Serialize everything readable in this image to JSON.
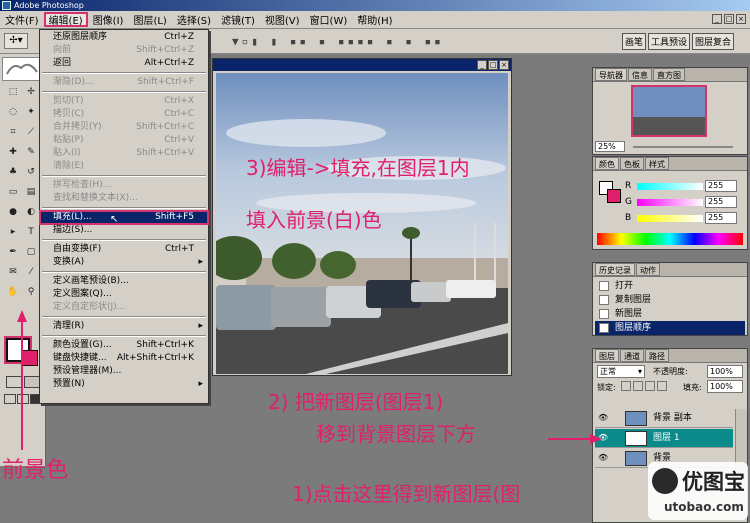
{
  "app": {
    "title": "Adobe Photoshop"
  },
  "menubar": [
    {
      "id": "file",
      "label": "文件(F)"
    },
    {
      "id": "edit",
      "label": "编辑(E)"
    },
    {
      "id": "image",
      "label": "图像(I)"
    },
    {
      "id": "layer",
      "label": "图层(L)"
    },
    {
      "id": "select",
      "label": "选择(S)"
    },
    {
      "id": "filter",
      "label": "滤镜(T)"
    },
    {
      "id": "view",
      "label": "视图(V)"
    },
    {
      "id": "window",
      "label": "窗口(W)"
    },
    {
      "id": "help",
      "label": "帮助(H)"
    }
  ],
  "options_bar": {
    "placeholder_text": "▼▫▮ ▮ ▪▪ ▪  ▪▪▪▪ ▪ ▪ ▪▪"
  },
  "right_toolbar": [
    "画笔",
    "工具预设",
    "图层复合"
  ],
  "edit_menu": [
    {
      "label": "还原图层顺序",
      "shortcut": "Ctrl+Z",
      "enabled": true
    },
    {
      "label": "向前",
      "shortcut": "Shift+Ctrl+Z",
      "enabled": false
    },
    {
      "label": "返回",
      "shortcut": "Alt+Ctrl+Z",
      "enabled": true
    },
    {
      "sep": true
    },
    {
      "label": "渐隐(D)...",
      "shortcut": "Shift+Ctrl+F",
      "enabled": false
    },
    {
      "sep": true
    },
    {
      "label": "剪切(T)",
      "shortcut": "Ctrl+X",
      "enabled": false
    },
    {
      "label": "拷贝(C)",
      "shortcut": "Ctrl+C",
      "enabled": false
    },
    {
      "label": "合并拷贝(Y)",
      "shortcut": "Shift+Ctrl+C",
      "enabled": false
    },
    {
      "label": "粘贴(P)",
      "shortcut": "Ctrl+V",
      "enabled": false
    },
    {
      "label": "贴入(I)",
      "shortcut": "Shift+Ctrl+V",
      "enabled": false
    },
    {
      "label": "清除(E)",
      "shortcut": "",
      "enabled": false
    },
    {
      "sep": true
    },
    {
      "label": "拼写检查(H)...",
      "shortcut": "",
      "enabled": false
    },
    {
      "label": "查找和替换文本(X)...",
      "shortcut": "",
      "enabled": false
    },
    {
      "sep": true
    },
    {
      "label": "填充(L)...",
      "shortcut": "Shift+F5",
      "enabled": true,
      "highlighted": true
    },
    {
      "label": "描边(S)...",
      "shortcut": "",
      "enabled": true
    },
    {
      "sep": true
    },
    {
      "label": "自由变换(F)",
      "shortcut": "Ctrl+T",
      "enabled": true
    },
    {
      "label": "变换(A)",
      "shortcut": "",
      "enabled": true,
      "submenu": true
    },
    {
      "sep": true
    },
    {
      "label": "定义画笔预设(B)...",
      "shortcut": "",
      "enabled": true
    },
    {
      "label": "定义图案(Q)...",
      "shortcut": "",
      "enabled": true
    },
    {
      "label": "定义自定形状(J)...",
      "shortcut": "",
      "enabled": false
    },
    {
      "sep": true
    },
    {
      "label": "清理(R)",
      "shortcut": "",
      "enabled": true,
      "submenu": true
    },
    {
      "sep": true
    },
    {
      "label": "颜色设置(G)...",
      "shortcut": "Shift+Ctrl+K",
      "enabled": true
    },
    {
      "label": "键盘快捷键...",
      "shortcut": "Alt+Shift+Ctrl+K",
      "enabled": true
    },
    {
      "label": "预设管理器(M)...",
      "shortcut": "",
      "enabled": true
    },
    {
      "label": "预置(N)",
      "shortcut": "",
      "enabled": true,
      "submenu": true
    }
  ],
  "navigator": {
    "tabs": [
      "导航器",
      "信息",
      "直方图"
    ],
    "zoom": "25%"
  },
  "color_panel": {
    "tabs": [
      "颜色",
      "色板",
      "样式"
    ],
    "r_label": "R",
    "g_label": "G",
    "b_label": "B",
    "r": "255",
    "g": "255",
    "b": "255"
  },
  "history": {
    "tabs": [
      "历史记录",
      "动作"
    ],
    "items": [
      "打开",
      "复制图层",
      "新图层",
      "图层顺序"
    ]
  },
  "layers": {
    "tabs": [
      "图层",
      "通道",
      "路径"
    ],
    "blend_mode": "正常",
    "opacity_label": "不透明度:",
    "opacity": "100%",
    "lock_label": "锁定:",
    "fill_label": "填充:",
    "fill": "100%",
    "items": [
      {
        "name": "背景 副本",
        "selected": false
      },
      {
        "name": "图层 1",
        "selected": true
      },
      {
        "name": "背景",
        "selected": false
      }
    ]
  },
  "annotations": {
    "step3_line1": "3)编辑->填充,在图层1内",
    "step3_line2": "填入前景(白)色",
    "step2_line1": "2) 把新图层(图层1)",
    "step2_line2": "移到背景图层下方",
    "step1": "1)点击这里得到新图层(图",
    "foreground": "前景色"
  },
  "watermark": {
    "brand": "优图宝",
    "domain": "utobao.com"
  },
  "colors": {
    "accent": "#e0206a",
    "highlight_outline": "#d4326e",
    "title_bg": "#0a246a"
  }
}
